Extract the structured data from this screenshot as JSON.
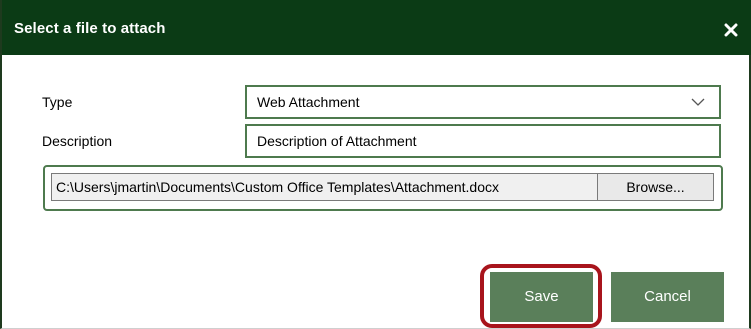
{
  "dialog": {
    "title": "Select a file to attach",
    "close_icon": "close-icon"
  },
  "form": {
    "type_label": "Type",
    "type_value": "Web Attachment",
    "description_label": "Description",
    "description_value": "Description of Attachment",
    "file_path": "C:\\Users\\jmartin\\Documents\\Custom Office Templates\\Attachment.docx",
    "browse_label": "Browse..."
  },
  "buttons": {
    "save_label": "Save",
    "cancel_label": "Cancel"
  },
  "colors": {
    "titlebar": "#0b3b15",
    "button": "#5a7f5a",
    "field_border": "#4e7a4e",
    "highlight": "#a8141c"
  }
}
